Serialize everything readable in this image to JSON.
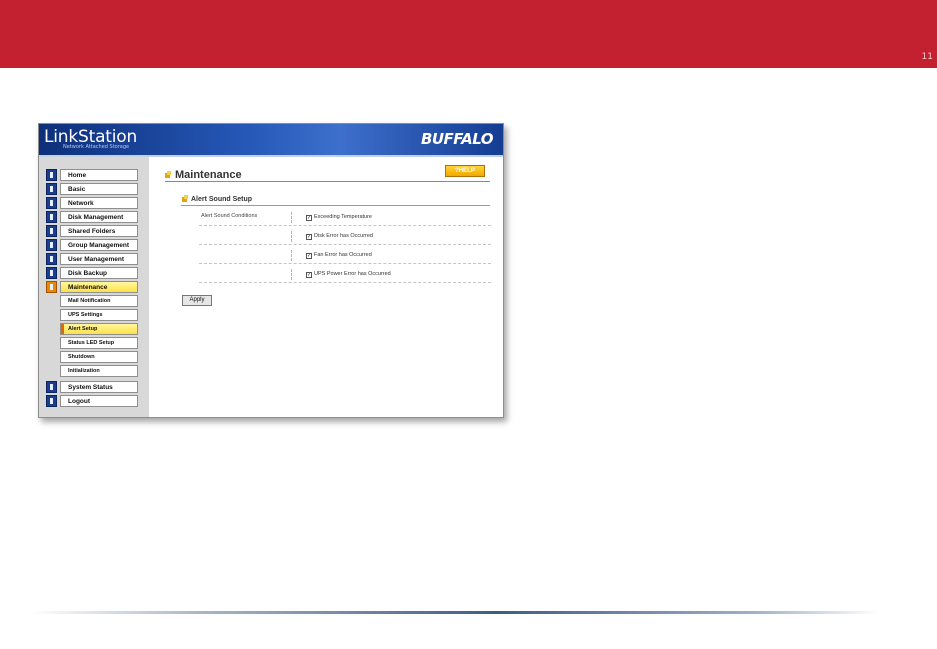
{
  "page": {
    "page_number": "11"
  },
  "app": {
    "logo": "LinkStation",
    "logo_subtitle": "Network Attached Storage",
    "brand": "BUFFALO"
  },
  "nav": {
    "items": [
      {
        "label": "Home"
      },
      {
        "label": "Basic"
      },
      {
        "label": "Network"
      },
      {
        "label": "Disk Management"
      },
      {
        "label": "Shared Folders"
      },
      {
        "label": "Group Management"
      },
      {
        "label": "User Management"
      },
      {
        "label": "Disk Backup"
      },
      {
        "label": "Maintenance"
      },
      {
        "label": "System Status"
      },
      {
        "label": "Logout"
      }
    ],
    "active": "Maintenance",
    "subitems": [
      {
        "label": "Mail Notification"
      },
      {
        "label": "UPS Settings"
      },
      {
        "label": "Alert Setup"
      },
      {
        "label": "Status LED Setup"
      },
      {
        "label": "Shutdown"
      },
      {
        "label": "Initialization"
      }
    ],
    "active_sub": "Alert Setup"
  },
  "main": {
    "title": "Maintenance",
    "help_label": "?HELP",
    "section_title": "Alert Sound Setup",
    "conditions_label": "Alert Sound Conditions",
    "options": [
      {
        "label": "Exceeding Temperature",
        "checked": true
      },
      {
        "label": "Disk Error has Occurred",
        "checked": true
      },
      {
        "label": "Fan Error has Occurred",
        "checked": true
      },
      {
        "label": "UPS Power Error has Occurred",
        "checked": true
      }
    ],
    "apply_label": "Apply"
  },
  "colors": {
    "top_bar": "#c42130",
    "header_blue": "#2658b8",
    "active_yellow": "#ffe044",
    "help_orange": "#f0a800"
  }
}
